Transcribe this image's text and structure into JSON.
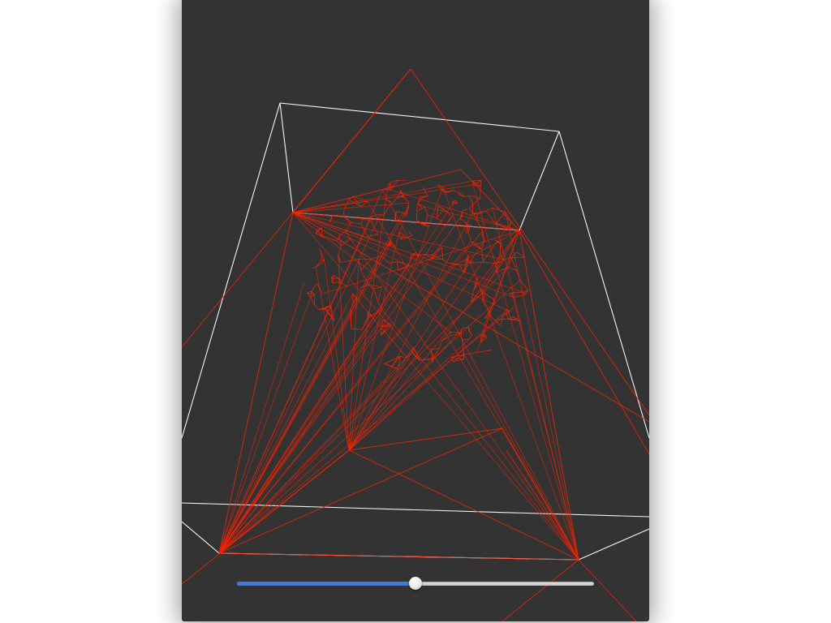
{
  "viewer": {
    "background_color": "#333333",
    "wireframe_color": "#ff2200",
    "frame_color": "#ffffff"
  },
  "slider": {
    "value": 0.5,
    "fill_color": "#3a7ae4"
  }
}
